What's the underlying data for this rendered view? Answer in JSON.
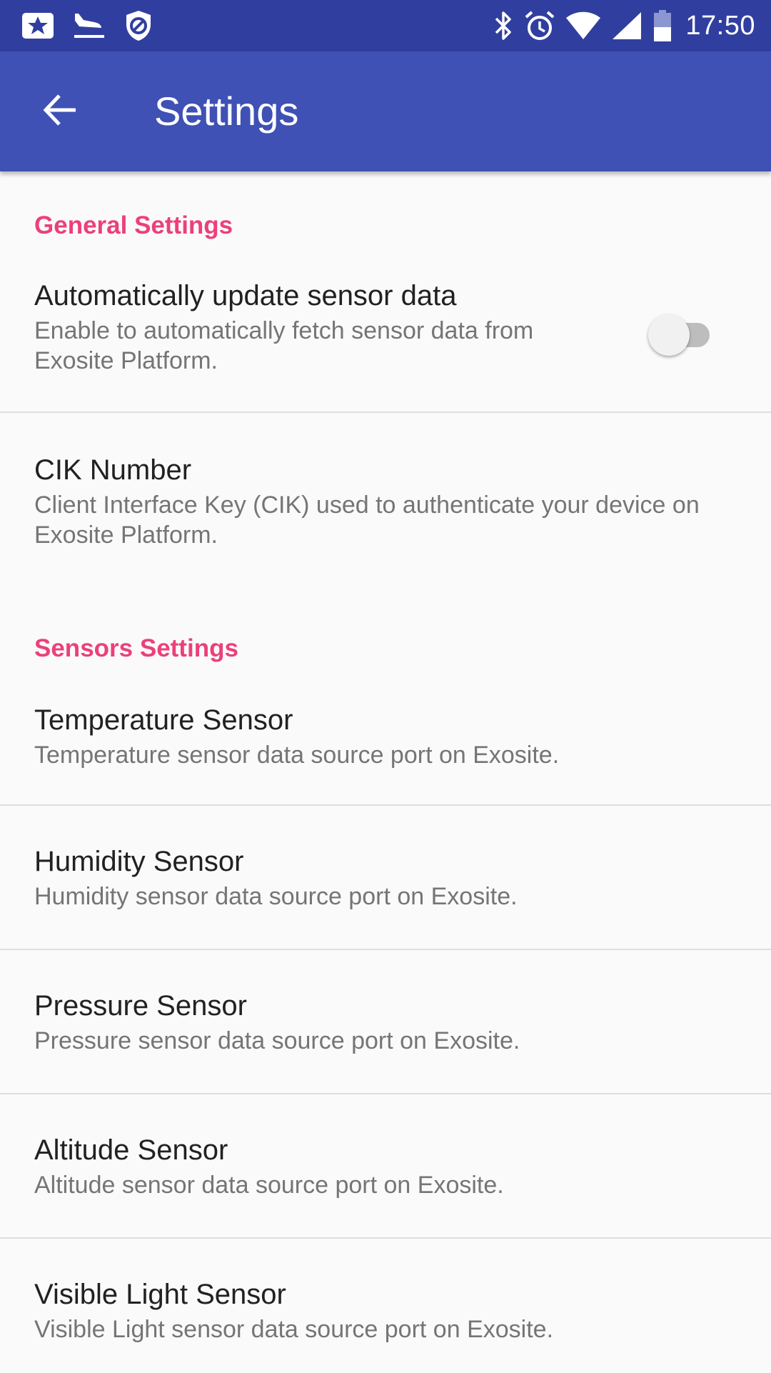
{
  "status_bar": {
    "time": "17:50",
    "left_icons": [
      "notification-star-icon",
      "airplane-landing-icon",
      "shield-block-icon"
    ],
    "right_icons": [
      "bluetooth-icon",
      "alarm-icon",
      "wifi-icon",
      "cell-signal-icon",
      "battery-icon"
    ]
  },
  "app_bar": {
    "title": "Settings",
    "back_icon": "arrow-back-icon"
  },
  "colors": {
    "status_bar": "#303f9f",
    "app_bar": "#3f51b5",
    "section_header": "#ec407a",
    "background": "#fafafa"
  },
  "general": {
    "header": "General Settings",
    "auto_update": {
      "title": "Automatically update sensor data",
      "summary": "Enable to automatically fetch sensor data from Exosite Platform.",
      "toggle_on": false
    },
    "cik": {
      "title": "CIK Number",
      "summary": "Client Interface Key (CIK) used to authenticate your device on Exosite Platform."
    }
  },
  "sensors": {
    "header": "Sensors Settings",
    "items": [
      {
        "title": "Temperature Sensor",
        "summary": "Temperature sensor data source port on Exosite."
      },
      {
        "title": "Humidity Sensor",
        "summary": "Humidity sensor data source port on Exosite."
      },
      {
        "title": "Pressure Sensor",
        "summary": "Pressure sensor data source port on Exosite."
      },
      {
        "title": "Altitude Sensor",
        "summary": "Altitude sensor data source port on Exosite."
      },
      {
        "title": "Visible Light Sensor",
        "summary": "Visible Light sensor data source port on Exosite."
      }
    ]
  }
}
